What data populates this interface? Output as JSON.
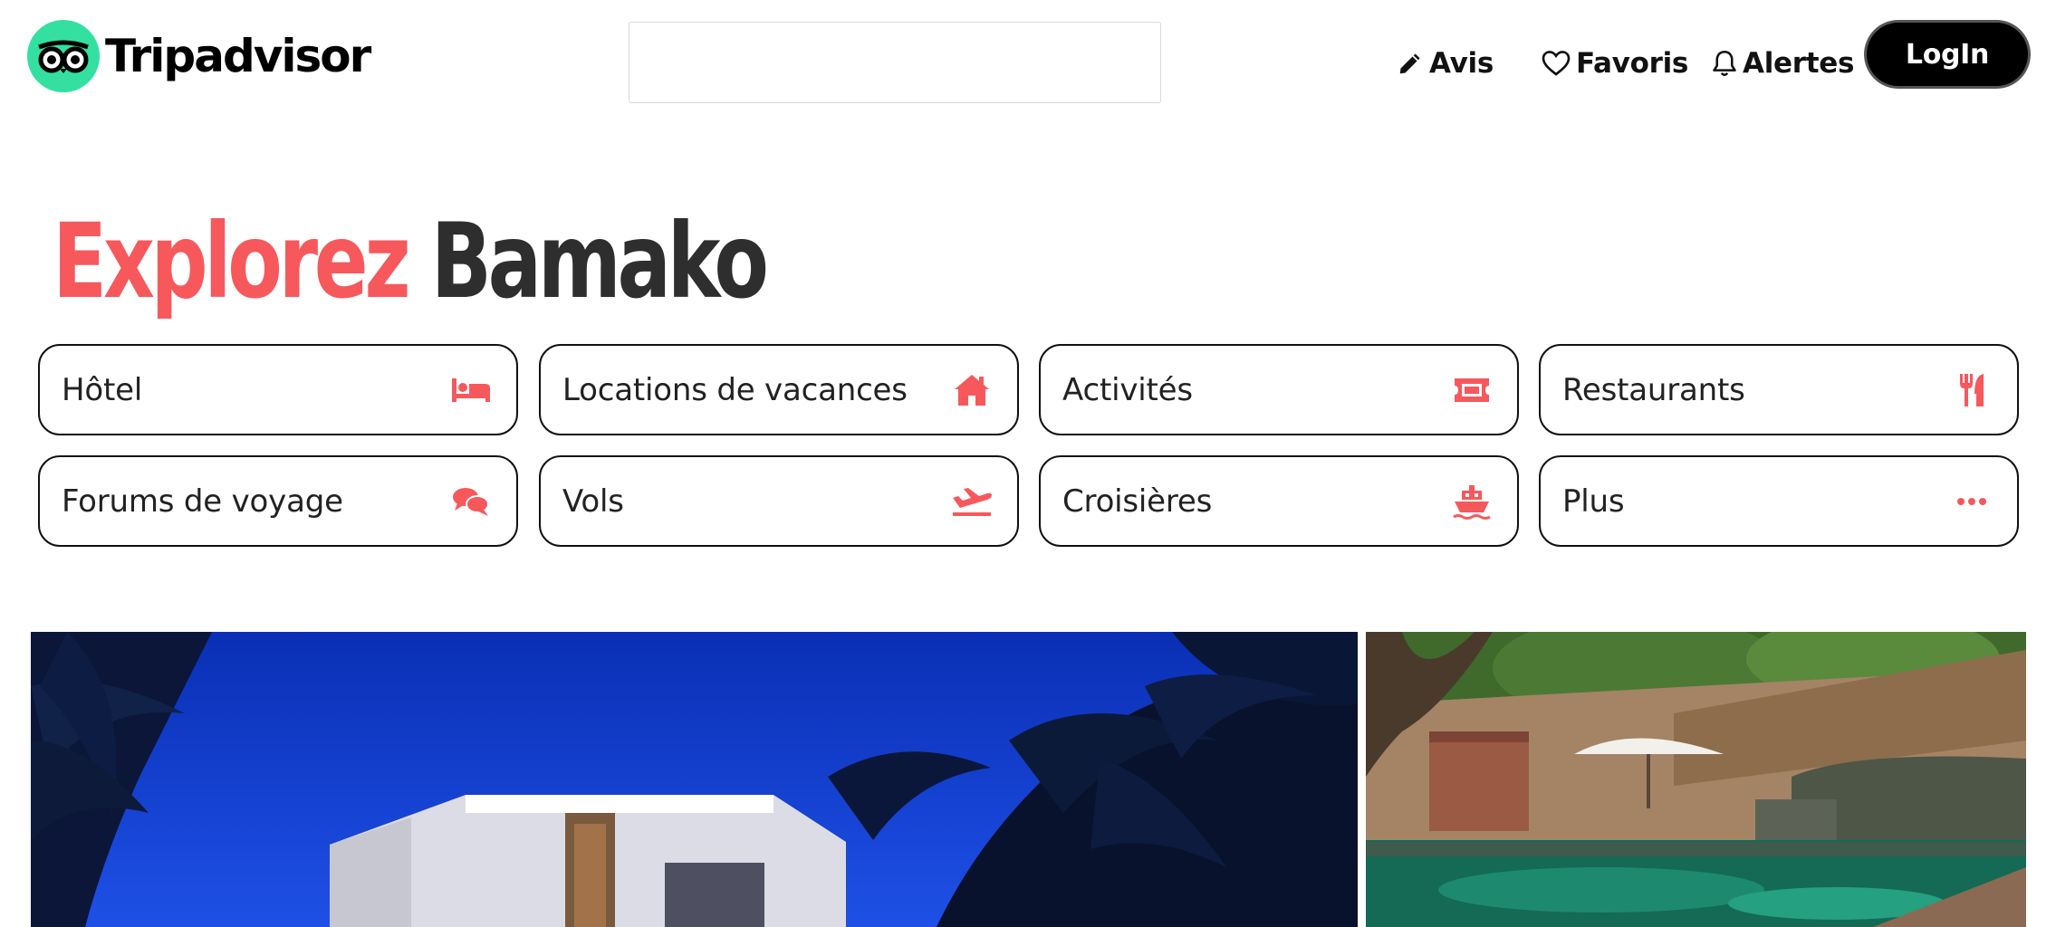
{
  "header": {
    "logo_text": "Tripadvisor",
    "search_placeholder": "",
    "nav": {
      "reviews": "Avis",
      "favorites": "Favoris",
      "alerts": "Alertes"
    },
    "login": "LogIn"
  },
  "title": {
    "accent": "Explorez",
    "place": "Bamako"
  },
  "categories": [
    {
      "label": "Hôtel",
      "icon": "bed-icon"
    },
    {
      "label": "Locations de vacances",
      "icon": "house-icon"
    },
    {
      "label": "Activités",
      "icon": "ticket-icon"
    },
    {
      "label": "Restaurants",
      "icon": "utensils-icon"
    },
    {
      "label": "Forums de voyage",
      "icon": "chat-bubbles-icon"
    },
    {
      "label": "Vols",
      "icon": "plane-departure-icon"
    },
    {
      "label": "Croisières",
      "icon": "ship-icon"
    },
    {
      "label": "Plus",
      "icon": "ellipsis-icon"
    }
  ],
  "colors": {
    "accent": "#f7585c",
    "logo_green": "#34e0a1",
    "dark": "#2e2e2e"
  }
}
